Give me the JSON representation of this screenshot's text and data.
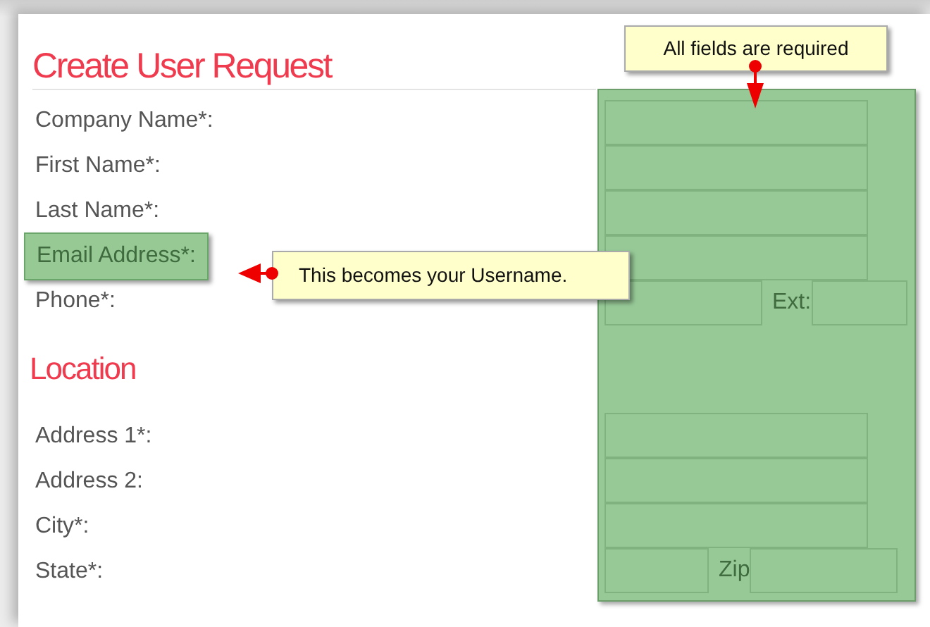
{
  "title": "Create User Request",
  "required_note": {
    "text": "All fields are required"
  },
  "contact_fields": [
    {
      "label": "Company Name*:",
      "kind": "text",
      "highlighted": false
    },
    {
      "label": "First Name*:",
      "kind": "text",
      "highlighted": false
    },
    {
      "label": "Last Name*:",
      "kind": "text",
      "highlighted": false
    },
    {
      "label": "Email Address*:",
      "kind": "text",
      "highlighted": true,
      "note": "This becomes your Username."
    },
    {
      "label": "Phone*:",
      "kind": "split",
      "highlighted": false,
      "extra_label": "Ext:"
    }
  ],
  "location": {
    "heading": "Location",
    "fields": [
      {
        "label": "Address 1*:",
        "kind": "text",
        "highlighted": false
      },
      {
        "label": "Address 2:",
        "kind": "text",
        "highlighted": false
      },
      {
        "label": "City*:",
        "kind": "text",
        "highlighted": false
      },
      {
        "label": "State*:",
        "kind": "split-short",
        "highlighted": false,
        "extra_label": "Zip"
      }
    ]
  }
}
